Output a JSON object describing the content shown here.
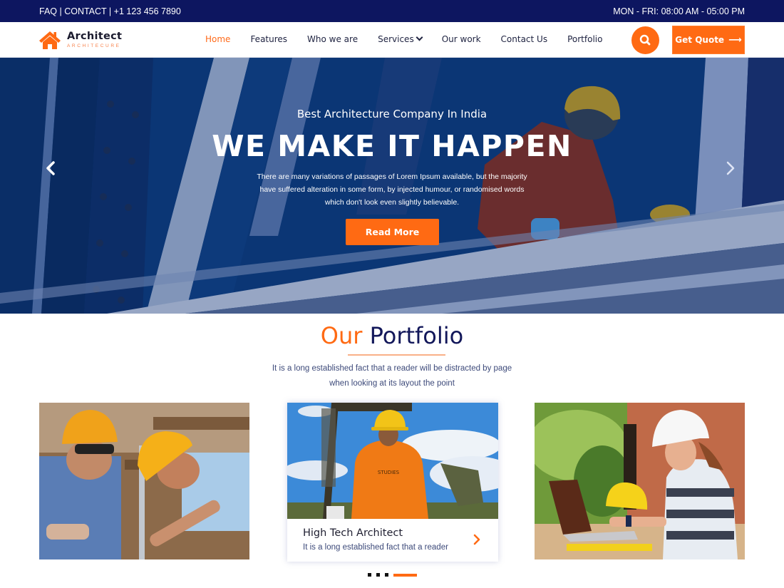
{
  "topbar": {
    "left_text": "FAQ | CONTACT | +1 123 456 7890",
    "right_text": "MON - FRI: 08:00 AM - 05:00 PM"
  },
  "header": {
    "logo": {
      "title": "Architect",
      "subtitle": "ARCHITECURE",
      "icon": "house-icon"
    },
    "nav": [
      {
        "label": "Home",
        "active": true
      },
      {
        "label": "Features",
        "active": false
      },
      {
        "label": "Who we are",
        "active": false
      },
      {
        "label": "Services",
        "active": false,
        "has_dropdown": true
      },
      {
        "label": "Our work",
        "active": false
      },
      {
        "label": "Contact Us",
        "active": false
      },
      {
        "label": "Portfolio",
        "active": false
      }
    ],
    "search_icon": "search-icon",
    "quote_button": {
      "label": "Get Quote",
      "icon": "arrow-right-icon"
    }
  },
  "hero": {
    "tagline": "Best Architecture Company In India",
    "title": "WE MAKE IT HAPPEN",
    "description": "There are many variations of passages of Lorem Ipsum available, but the majority have suffered alteration in some form, by injected humour, or randomised words which don't look even slightly believable.",
    "button_label": "Read More",
    "prev_icon": "chevron-left-icon",
    "next_icon": "chevron-right-icon"
  },
  "portfolio": {
    "title_accent": "Our",
    "title_main": "Portfolio",
    "description": "It is a long established fact that a reader will be distracted by page when looking at its layout the point",
    "cards": [
      {
        "image": "two construction workers in hard hats"
      },
      {
        "image": "worker in orange coverall at oil pump",
        "title": "High Tech Architect",
        "text": "It is a long established fact that a reader"
      },
      {
        "image": "woman engineer with laptop and hard hat"
      }
    ],
    "carousel": {
      "total": 4,
      "active": 4
    }
  },
  "colors": {
    "accent": "#ff6a13",
    "navy": "#0d1660",
    "title_dark": "#12175a",
    "text_muted": "#3d4a7a"
  }
}
